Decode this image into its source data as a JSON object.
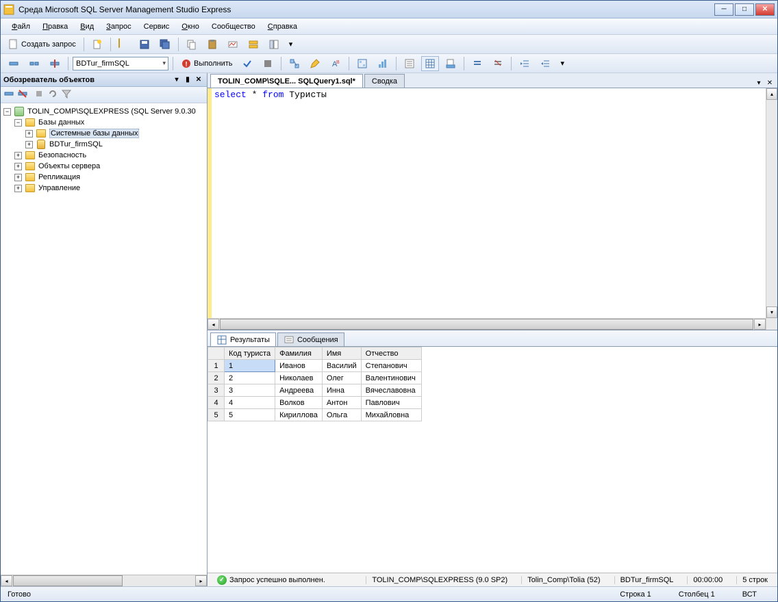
{
  "window": {
    "title": "Среда Microsoft SQL Server Management Studio Express"
  },
  "menu": {
    "file": "Файл",
    "edit": "Правка",
    "view": "Вид",
    "query": "Запрос",
    "service": "Сервис",
    "window": "Окно",
    "community": "Сообщество",
    "help": "Справка"
  },
  "toolbar1": {
    "new_query": "Создать запрос"
  },
  "toolbar2": {
    "db_combo": "BDTur_firmSQL",
    "execute": "Выполнить"
  },
  "object_explorer": {
    "title": "Обозреватель объектов",
    "root": "TOLIN_COMP\\SQLEXPRESS (SQL Server 9.0.30",
    "databases": "Базы данных",
    "system_dbs": "Системные базы данных",
    "user_db": "BDTur_firmSQL",
    "security": "Безопасность",
    "server_objects": "Объекты сервера",
    "replication": "Репликация",
    "management": "Управление"
  },
  "tabs": {
    "active": "TOLIN_COMP\\SQLE... SQLQuery1.sql*",
    "summary": "Сводка"
  },
  "editor": {
    "kw_select": "select",
    "star": " * ",
    "kw_from": "from",
    "table": " Туристы"
  },
  "results_tabs": {
    "results": "Результаты",
    "messages": "Сообщения"
  },
  "grid": {
    "columns": [
      "Код туриста",
      "Фамилия",
      "Имя",
      "Отчество"
    ],
    "rows": [
      {
        "n": "1",
        "id": "1",
        "fam": "Иванов",
        "name": "Василий",
        "patr": "Степанович"
      },
      {
        "n": "2",
        "id": "2",
        "fam": "Николаев",
        "name": "Олег",
        "patr": "Валентинович"
      },
      {
        "n": "3",
        "id": "3",
        "fam": "Андреева",
        "name": "Инна",
        "patr": "Вячеславовна"
      },
      {
        "n": "4",
        "id": "4",
        "fam": "Волков",
        "name": "Антон",
        "patr": "Павлович"
      },
      {
        "n": "5",
        "id": "5",
        "fam": "Кириллова",
        "name": "Ольга",
        "patr": "Михайловна"
      }
    ]
  },
  "results_status": {
    "ok": "Запрос успешно выполнен.",
    "server": "TOLIN_COMP\\SQLEXPRESS (9.0 SP2)",
    "user": "Tolin_Comp\\Tolia (52)",
    "db": "BDTur_firmSQL",
    "time": "00:00:00",
    "rows": "5 строк"
  },
  "app_status": {
    "ready": "Готово",
    "line": "Строка 1",
    "col": "Столбец 1",
    "ins": "ВСТ"
  }
}
